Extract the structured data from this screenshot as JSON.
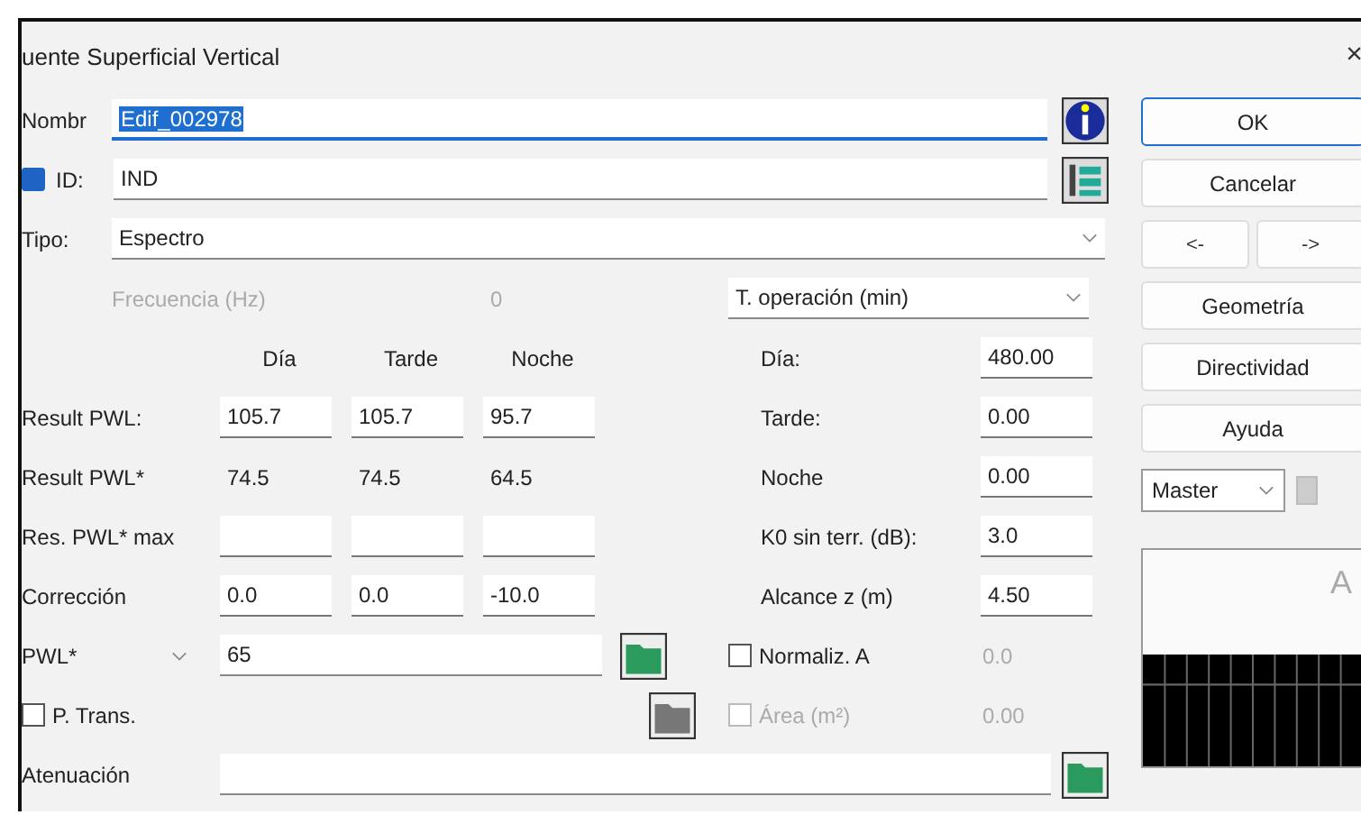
{
  "window": {
    "title": "uente Superficial Vertical",
    "close": "×"
  },
  "name": {
    "label": "Nombr",
    "value": "Edif_002978",
    "highlighted": true
  },
  "id": {
    "label": "ID:",
    "value": "IND",
    "checked": true
  },
  "type": {
    "label": "Tipo:",
    "value": "Espectro"
  },
  "frequency": {
    "label": "Frecuencia (Hz)",
    "value": "0",
    "disabled": true
  },
  "operation": {
    "value": "T. operación (min)"
  },
  "periods": [
    "Día",
    "Tarde",
    "Noche"
  ],
  "result_rows": [
    {
      "label": "Result PWL:",
      "values": [
        "105.7",
        "105.7",
        "95.7"
      ]
    },
    {
      "label": "Result PWL*",
      "values": [
        "74.5",
        "74.5",
        "64.5"
      ]
    },
    {
      "label": "Res. PWL* max",
      "values": []
    },
    {
      "label": "Corrección",
      "values": [
        "0.0",
        "0.0",
        "-10.0"
      ]
    }
  ],
  "times": [
    {
      "label": "Día:",
      "value": "480.00"
    },
    {
      "label": "Tarde:",
      "value": "0.00"
    },
    {
      "label": "Noche",
      "value": "0.00"
    }
  ],
  "k0": {
    "label": "K0 sin terr. (dB):",
    "value": "3.0"
  },
  "reach": {
    "label": "Alcance z (m)",
    "value": "4.50"
  },
  "pwl": {
    "select": "PWL*",
    "value": "65"
  },
  "p_trans": {
    "label": "P. Trans.",
    "checked": false
  },
  "normaliz": {
    "label": "Normaliz. A",
    "checked": false,
    "value": "0.0"
  },
  "area": {
    "label": "Área (m²)",
    "checked": false,
    "disabled": true,
    "value": "0.00"
  },
  "attenuation": {
    "label": "Atenuación"
  },
  "buttons": [
    {
      "kind": "ok",
      "label": "OK"
    },
    {
      "kind": "normal",
      "label": "Cancelar"
    }
  ],
  "nav": [
    "<-",
    "->"
  ],
  "buttons2": [
    "Geometría",
    "Directividad",
    "Ayuda"
  ],
  "master": {
    "value": "Master"
  },
  "chart_letter": "A"
}
